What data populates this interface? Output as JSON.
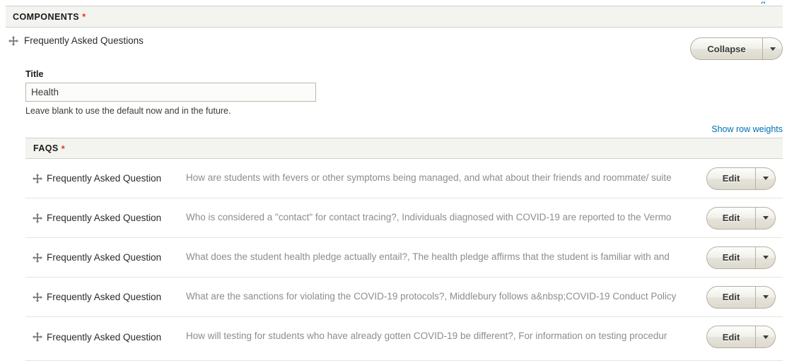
{
  "top_fragment": {
    "text": "g"
  },
  "components_section": {
    "title": "COMPONENTS",
    "required_marker": "*",
    "component": {
      "name": "Frequently Asked Questions",
      "drag_icon": "move-cross-icon",
      "collapse_button": {
        "label": "Collapse",
        "dropdown_icon": "chevron-down-icon"
      },
      "title_field": {
        "label": "Title",
        "value": "Health",
        "placeholder": "",
        "description": "Leave blank to use the default now and in the future."
      },
      "row_weights_link": "Show row weights",
      "faqs_table": {
        "header": "FAQS",
        "required_marker": "*",
        "row_type_label": "Frequently Asked Question",
        "edit_label": "Edit",
        "edit_dropdown_icon": "chevron-down-icon",
        "drag_icon": "move-cross-icon",
        "rows": [
          {
            "type": "Frequently Asked Question",
            "summary": "How are students with fevers or other symptoms being managed, and what about their friends and roommate/ suite"
          },
          {
            "type": "Frequently Asked Question",
            "summary": "Who is considered a \"contact\" for contact tracing?, Individuals diagnosed with COVID-19 are reported to the Vermo"
          },
          {
            "type": "Frequently Asked Question",
            "summary": "What does the student health pledge actually entail?, The health pledge affirms that the student is familiar with and"
          },
          {
            "type": "Frequently Asked Question",
            "summary": "What are the sanctions for violating the COVID-19 protocols?, Middlebury follows a&nbsp;COVID-19 Conduct Policy"
          },
          {
            "type": "Frequently Asked Question",
            "summary": "How will testing for students who have already gotten COVID-19 be different?, For information on testing procedur"
          }
        ]
      }
    }
  },
  "colors": {
    "link": "#0071b3",
    "required": "#ee3322",
    "header_bg": "#f3f4ef",
    "summary_text": "#8d8d8d"
  }
}
